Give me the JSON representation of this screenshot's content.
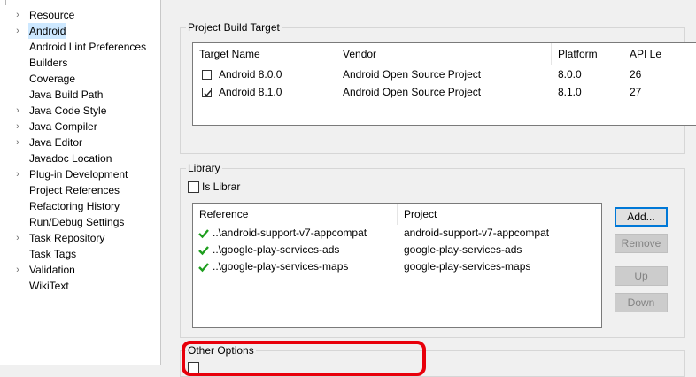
{
  "tree": {
    "items": [
      {
        "label": "Resource",
        "chevron": "›"
      },
      {
        "label": "Android",
        "chevron": "›"
      },
      {
        "label": "Android Lint Preferences",
        "chevron": ""
      },
      {
        "label": "Builders",
        "chevron": ""
      },
      {
        "label": "Coverage",
        "chevron": ""
      },
      {
        "label": "Java Build Path",
        "chevron": ""
      },
      {
        "label": "Java Code Style",
        "chevron": "›"
      },
      {
        "label": "Java Compiler",
        "chevron": "›"
      },
      {
        "label": "Java Editor",
        "chevron": "›"
      },
      {
        "label": "Javadoc Location",
        "chevron": ""
      },
      {
        "label": "Plug-in Development",
        "chevron": "›"
      },
      {
        "label": "Project References",
        "chevron": ""
      },
      {
        "label": "Refactoring History",
        "chevron": ""
      },
      {
        "label": "Run/Debug Settings",
        "chevron": ""
      },
      {
        "label": "Task Repository",
        "chevron": "›"
      },
      {
        "label": "Task Tags",
        "chevron": ""
      },
      {
        "label": "Validation",
        "chevron": "›"
      },
      {
        "label": "WikiText",
        "chevron": ""
      }
    ],
    "selected": "Android"
  },
  "build_target": {
    "title": "Project Build Target",
    "columns": [
      "Target Name",
      "Vendor",
      "Platform",
      "API Le"
    ],
    "rows": [
      {
        "name": "Android 8.0.0",
        "vendor": "Android Open Source Project",
        "platform": "8.0.0",
        "api": "26",
        "checked": false
      },
      {
        "name": "Android 8.1.0",
        "vendor": "Android Open Source Project",
        "platform": "8.1.0",
        "api": "27",
        "checked": true
      }
    ]
  },
  "library": {
    "title": "Library",
    "is_library_label": "Is Librar",
    "is_library_checked": false,
    "columns": [
      "Reference",
      "Project"
    ],
    "rows": [
      {
        "reference": "..\\android-support-v7-appcompat",
        "project": "android-support-v7-appcompat"
      },
      {
        "reference": "..\\google-play-services-ads",
        "project": "google-play-services-ads"
      },
      {
        "reference": "..\\google-play-services-maps",
        "project": "google-play-services-maps"
      }
    ],
    "buttons": {
      "add": "Add...",
      "remove": "Remove",
      "up": "Up",
      "down": "Down"
    }
  },
  "other_options": {
    "title": "Other Options"
  },
  "colors": {
    "highlight": "#e8000b",
    "selection": "#cde8ff",
    "check_green": "#1e9e1e"
  }
}
